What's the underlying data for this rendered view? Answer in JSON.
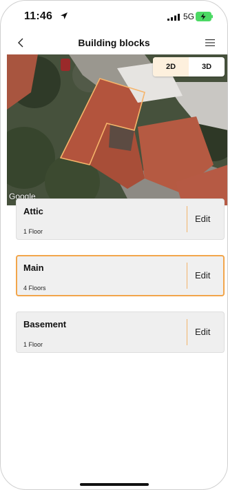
{
  "status_bar": {
    "time": "11:46",
    "network": "5G"
  },
  "nav": {
    "title": "Building blocks"
  },
  "map": {
    "view_modes": [
      "2D",
      "3D"
    ],
    "active_view": "2D",
    "attribution": "Google"
  },
  "blocks": [
    {
      "name": "Attic",
      "floors": "1 Floor",
      "edit_label": "Edit",
      "selected": false
    },
    {
      "name": "Main",
      "floors": "4 Floors",
      "edit_label": "Edit",
      "selected": true
    },
    {
      "name": "Basement",
      "floors": "1 Floor",
      "edit_label": "Edit",
      "selected": false
    }
  ],
  "colors": {
    "accent": "#f2a54a",
    "selected_toggle_bg": "#fdf0dd",
    "card_bg": "#efefef",
    "battery_green": "#4cd964"
  },
  "icons": [
    "location-arrow-icon",
    "signal-icon",
    "battery-charging-icon",
    "back-chevron-icon",
    "hamburger-menu-icon"
  ]
}
